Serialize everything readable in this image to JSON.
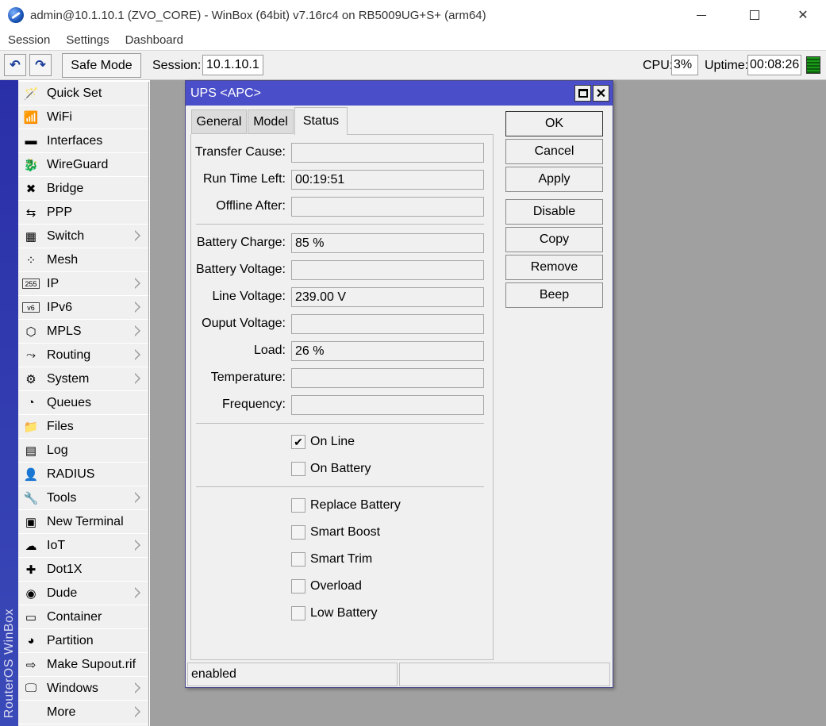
{
  "window": {
    "title": "admin@10.1.10.1 (ZVO_CORE) - WinBox (64bit) v7.16rc4 on RB5009UG+S+ (arm64)",
    "minimize_icon": "minimize-icon",
    "maximize_icon": "maximize-icon",
    "close_icon": "close-icon"
  },
  "menubar": {
    "session": "Session",
    "settings": "Settings",
    "dashboard": "Dashboard"
  },
  "toolbar": {
    "undo_icon": "↶",
    "redo_icon": "↷",
    "safe_mode": "Safe Mode",
    "session_label": "Session:",
    "session_value": "10.1.10.1",
    "cpu_label": "CPU:",
    "cpu_value": "3%",
    "uptime_label": "Uptime:",
    "uptime_value": "00:08:26"
  },
  "side_banner": "RouterOS WinBox",
  "sidebar": {
    "items": [
      {
        "label": "Quick Set",
        "icon": "🪄",
        "submenu": false
      },
      {
        "label": "WiFi",
        "icon": "📶",
        "submenu": false
      },
      {
        "label": "Interfaces",
        "icon": "▬",
        "submenu": false
      },
      {
        "label": "WireGuard",
        "icon": "🐉",
        "submenu": false
      },
      {
        "label": "Bridge",
        "icon": "✖",
        "submenu": false
      },
      {
        "label": "PPP",
        "icon": "⇆",
        "submenu": false
      },
      {
        "label": "Switch",
        "icon": "▦",
        "submenu": true
      },
      {
        "label": "Mesh",
        "icon": "⁘",
        "submenu": false
      },
      {
        "label": "IP",
        "icon": "255",
        "submenu": true
      },
      {
        "label": "IPv6",
        "icon": "v6",
        "submenu": true
      },
      {
        "label": "MPLS",
        "icon": "⬡",
        "submenu": true
      },
      {
        "label": "Routing",
        "icon": "⤳",
        "submenu": true
      },
      {
        "label": "System",
        "icon": "⚙",
        "submenu": true
      },
      {
        "label": "Queues",
        "icon": "◔",
        "submenu": false
      },
      {
        "label": "Files",
        "icon": "📁",
        "submenu": false
      },
      {
        "label": "Log",
        "icon": "▤",
        "submenu": false
      },
      {
        "label": "RADIUS",
        "icon": "👤",
        "submenu": false
      },
      {
        "label": "Tools",
        "icon": "🔧",
        "submenu": true
      },
      {
        "label": "New Terminal",
        "icon": "▣",
        "submenu": false
      },
      {
        "label": "IoT",
        "icon": "☁",
        "submenu": true
      },
      {
        "label": "Dot1X",
        "icon": "✚",
        "submenu": false
      },
      {
        "label": "Dude",
        "icon": "◉",
        "submenu": true
      },
      {
        "label": "Container",
        "icon": "▭",
        "submenu": false
      },
      {
        "label": "Partition",
        "icon": "◕",
        "submenu": false
      },
      {
        "label": "Make Supout.rif",
        "icon": "⇨",
        "submenu": false
      },
      {
        "label": "Windows",
        "icon": "🖵",
        "submenu": true
      },
      {
        "label": "More",
        "icon": "",
        "submenu": true
      }
    ]
  },
  "dialog": {
    "title": "UPS <APC>",
    "tabs": {
      "general": "General",
      "model": "Model",
      "status": "Status"
    },
    "fields": {
      "transfer_cause": {
        "label": "Transfer Cause:",
        "value": ""
      },
      "run_time_left": {
        "label": "Run Time Left:",
        "value": "00:19:51"
      },
      "offline_after": {
        "label": "Offline After:",
        "value": ""
      },
      "battery_charge": {
        "label": "Battery Charge:",
        "value": "85 %"
      },
      "battery_voltage": {
        "label": "Battery Voltage:",
        "value": ""
      },
      "line_voltage": {
        "label": "Line Voltage:",
        "value": "239.00 V"
      },
      "output_voltage": {
        "label": "Ouput Voltage:",
        "value": ""
      },
      "load": {
        "label": "Load:",
        "value": "26 %"
      },
      "temperature": {
        "label": "Temperature:",
        "value": ""
      },
      "frequency": {
        "label": "Frequency:",
        "value": ""
      }
    },
    "checks": {
      "on_line": {
        "label": "On Line",
        "checked": true,
        "mark": "✔"
      },
      "on_battery": {
        "label": "On Battery",
        "checked": false,
        "mark": ""
      },
      "replace_battery": {
        "label": "Replace Battery",
        "checked": false,
        "mark": ""
      },
      "smart_boost": {
        "label": "Smart Boost",
        "checked": false,
        "mark": ""
      },
      "smart_trim": {
        "label": "Smart Trim",
        "checked": false,
        "mark": ""
      },
      "overload": {
        "label": "Overload",
        "checked": false,
        "mark": ""
      },
      "low_battery": {
        "label": "Low Battery",
        "checked": false,
        "mark": ""
      }
    },
    "buttons": {
      "ok": "OK",
      "cancel": "Cancel",
      "apply": "Apply",
      "disable": "Disable",
      "copy": "Copy",
      "remove": "Remove",
      "beep": "Beep"
    },
    "status_bar": {
      "state": "enabled",
      "extra": ""
    }
  },
  "colors": {
    "dialog_title_bg": "#4a4ec8",
    "side_banner_bg": "#2a2fa8",
    "workspace_bg": "#a0a0a0"
  }
}
